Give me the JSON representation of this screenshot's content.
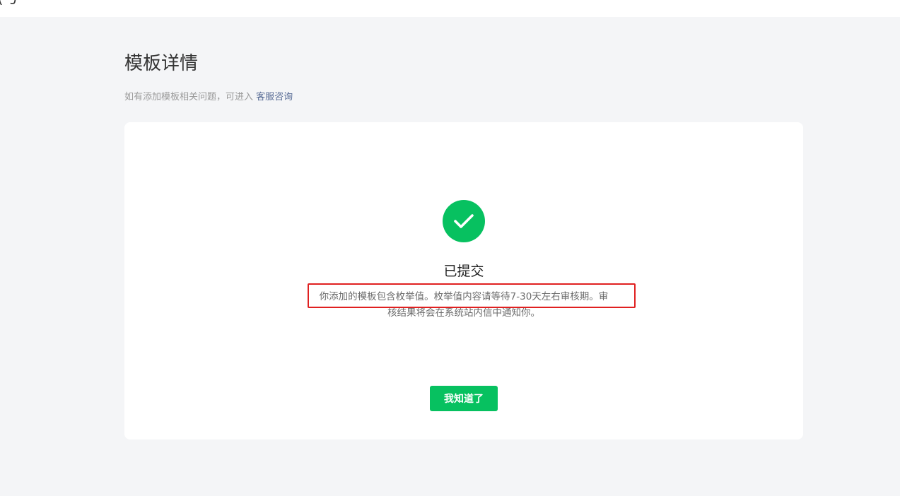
{
  "header": {
    "fragment_text": "(号"
  },
  "page": {
    "title": "模板详情",
    "help_text": "如有添加模板相关问题，可进入",
    "help_link": "客服咨询"
  },
  "result": {
    "icon": "checkmark-icon",
    "status": "已提交",
    "description": "你添加的模板包含枚举值。枚举值内容请等待7-30天左右审核期。审核结果将会在系统站内信中通知你。",
    "button_label": "我知道了"
  },
  "colors": {
    "accent": "#07c160",
    "link": "#576b95",
    "highlight_border": "#e02020",
    "background": "#f4f5f7"
  }
}
